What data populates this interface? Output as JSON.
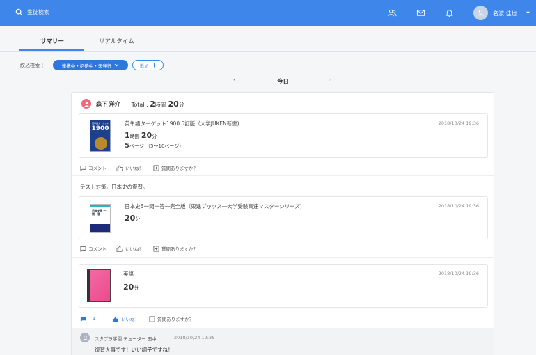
{
  "topbar": {
    "search_label": "生徒検索",
    "user_name": "名波 佳也",
    "icons": [
      "users-icon",
      "mail-icon",
      "bell-icon"
    ],
    "accent_color": "#3f86ea"
  },
  "tabs": [
    {
      "label": "サマリー",
      "active": true
    },
    {
      "label": "リアルタイム",
      "active": false
    }
  ],
  "filter": {
    "label": "絞込検索 ：",
    "selected": "連携中・招待中・未発行",
    "add_label": "追加"
  },
  "date_nav": {
    "label": "今日"
  },
  "summary": {
    "user_name": "森下 洋介",
    "total_prefix": "Total :",
    "total_hours": "2",
    "hours_unit": "時間",
    "total_minutes": "20",
    "minutes_unit": "分"
  },
  "entries": [
    {
      "title": "英単語ターゲット1900 5訂版（大学JUKEN新書)",
      "date": "2018/10/24 19:36",
      "hours": "1",
      "hours_unit": "時間",
      "minutes": "20",
      "minutes_unit": "分",
      "pages": "5",
      "pages_detail": "ページ （5〜10ページ）",
      "cover_text": "英単語ターゲット",
      "cover_number": "1900"
    },
    {
      "title": "日本史B一問一答―完全版（東進ブックス―大学受験高速マスターシリーズ)",
      "date": "2018/10/24 19:36",
      "minutes": "20",
      "minutes_unit": "分",
      "cover_text": "日本史B 一問一答"
    },
    {
      "title": "英語",
      "date": "2018/10/24 19:36",
      "minutes": "20",
      "minutes_unit": "分"
    }
  ],
  "actions": {
    "comment": "コメント",
    "like": "いいね！",
    "question": "質問ありますか？",
    "comment_count": "1"
  },
  "note": "テスト対策。日本史の復習。",
  "comment": {
    "author": "スタプラ学園 チューター 田中",
    "date": "2018/10/24 19:36",
    "text": "復習大事です！いい調子ですね！"
  }
}
